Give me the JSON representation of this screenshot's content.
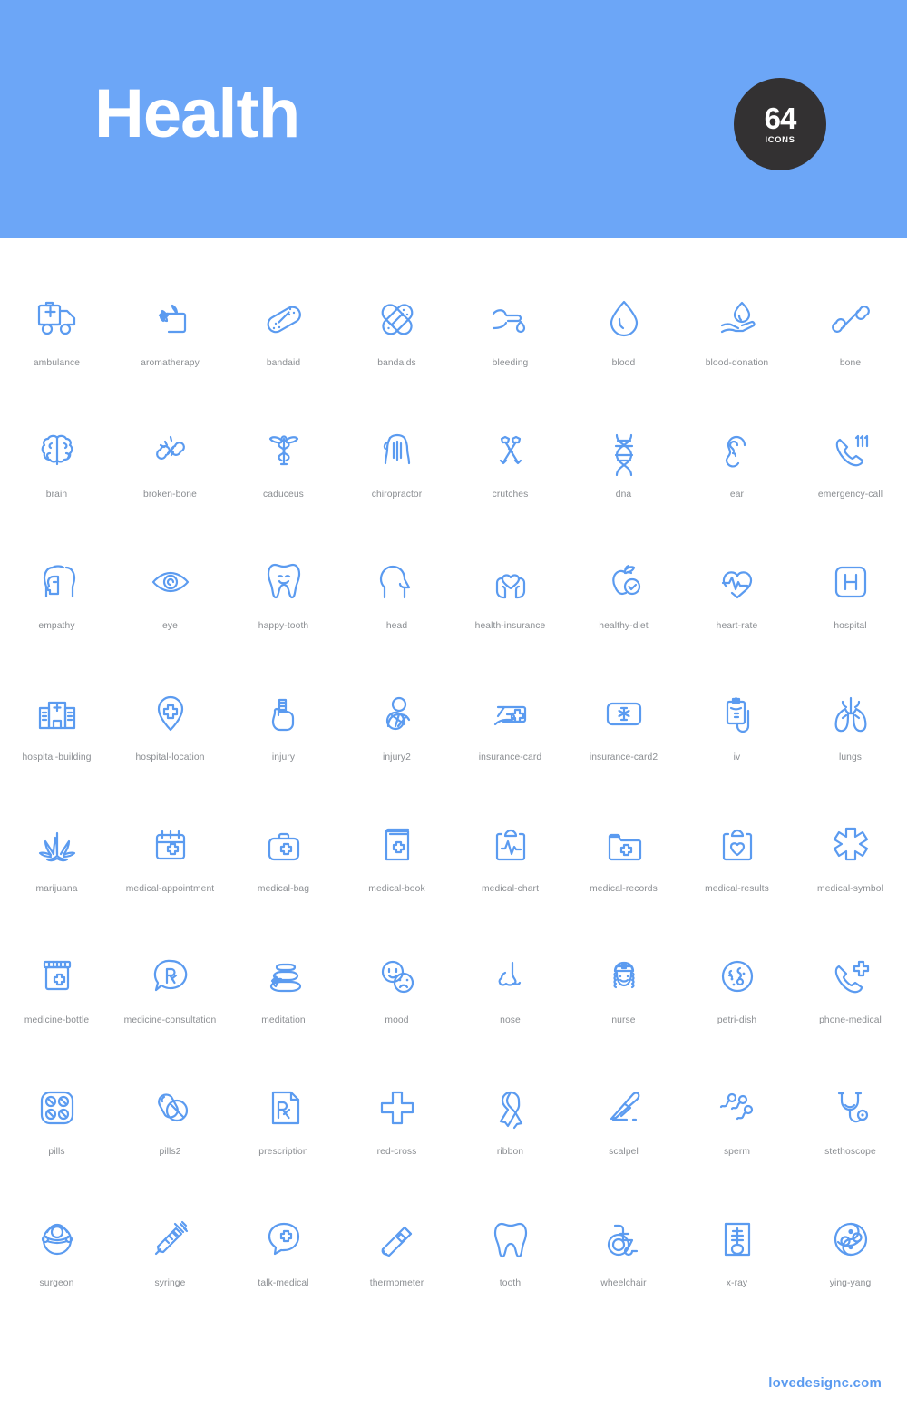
{
  "header": {
    "title": "Health",
    "badge_count": "64",
    "badge_label": "ICONS",
    "background_color": "#6ca6f7"
  },
  "theme": {
    "icon_color": "#5b9bf0",
    "label_color": "#8a8d91",
    "badge_color": "#333132",
    "page_background": "#ffffff"
  },
  "footer": {
    "site": "lovedesignc.com"
  },
  "grid": {
    "columns": 8,
    "rows": 8,
    "total": 64,
    "icons": [
      {
        "name": "ambulance",
        "label": "ambulance"
      },
      {
        "name": "aromatherapy",
        "label": "aromatherapy"
      },
      {
        "name": "bandaid",
        "label": "bandaid"
      },
      {
        "name": "bandaids",
        "label": "bandaids"
      },
      {
        "name": "bleeding",
        "label": "bleeding"
      },
      {
        "name": "blood",
        "label": "blood"
      },
      {
        "name": "blood-donation",
        "label": "blood-donation"
      },
      {
        "name": "bone",
        "label": "bone"
      },
      {
        "name": "brain",
        "label": "brain"
      },
      {
        "name": "broken-bone",
        "label": "broken-bone"
      },
      {
        "name": "caduceus",
        "label": "caduceus"
      },
      {
        "name": "chiropractor",
        "label": "chiropractor"
      },
      {
        "name": "crutches",
        "label": "crutches"
      },
      {
        "name": "dna",
        "label": "dna"
      },
      {
        "name": "ear",
        "label": "ear"
      },
      {
        "name": "emergency-call",
        "label": "emergency-call"
      },
      {
        "name": "empathy",
        "label": "empathy"
      },
      {
        "name": "eye",
        "label": "eye"
      },
      {
        "name": "happy-tooth",
        "label": "happy-tooth"
      },
      {
        "name": "head",
        "label": "head"
      },
      {
        "name": "health-insurance",
        "label": "health-insurance"
      },
      {
        "name": "healthy-diet",
        "label": "healthy-diet"
      },
      {
        "name": "heart-rate",
        "label": "heart-rate"
      },
      {
        "name": "hospital",
        "label": "hospital"
      },
      {
        "name": "hospital-building",
        "label": "hospital-building"
      },
      {
        "name": "hospital-location",
        "label": "hospital-location"
      },
      {
        "name": "injury",
        "label": "injury"
      },
      {
        "name": "injury2",
        "label": "injury2"
      },
      {
        "name": "insurance-card",
        "label": "insurance-card"
      },
      {
        "name": "insurance-card2",
        "label": "insurance-card2"
      },
      {
        "name": "iv",
        "label": "iv"
      },
      {
        "name": "lungs",
        "label": "lungs"
      },
      {
        "name": "marijuana",
        "label": "marijuana"
      },
      {
        "name": "medical-appointment",
        "label": "medical-appointment"
      },
      {
        "name": "medical-bag",
        "label": "medical-bag"
      },
      {
        "name": "medical-book",
        "label": "medical-book"
      },
      {
        "name": "medical-chart",
        "label": "medical-chart"
      },
      {
        "name": "medical-records",
        "label": "medical-records"
      },
      {
        "name": "medical-results",
        "label": "medical-results"
      },
      {
        "name": "medical-symbol",
        "label": "medical-symbol"
      },
      {
        "name": "medicine-bottle",
        "label": "medicine-bottle"
      },
      {
        "name": "medicine-consultation",
        "label": "medicine-consultation"
      },
      {
        "name": "meditation",
        "label": "meditation"
      },
      {
        "name": "mood",
        "label": "mood"
      },
      {
        "name": "nose",
        "label": "nose"
      },
      {
        "name": "nurse",
        "label": "nurse"
      },
      {
        "name": "petri-dish",
        "label": "petri-dish"
      },
      {
        "name": "phone-medical",
        "label": "phone-medical"
      },
      {
        "name": "pills",
        "label": "pills"
      },
      {
        "name": "pills2",
        "label": "pills2"
      },
      {
        "name": "prescription",
        "label": "prescription"
      },
      {
        "name": "red-cross",
        "label": "red-cross"
      },
      {
        "name": "ribbon",
        "label": "ribbon"
      },
      {
        "name": "scalpel",
        "label": "scalpel"
      },
      {
        "name": "sperm",
        "label": "sperm"
      },
      {
        "name": "stethoscope",
        "label": "stethoscope"
      },
      {
        "name": "surgeon",
        "label": "surgeon"
      },
      {
        "name": "syringe",
        "label": "syringe"
      },
      {
        "name": "talk-medical",
        "label": "talk-medical"
      },
      {
        "name": "thermometer",
        "label": "thermometer"
      },
      {
        "name": "tooth",
        "label": "tooth"
      },
      {
        "name": "wheelchair",
        "label": "wheelchair"
      },
      {
        "name": "x-ray",
        "label": "x-ray"
      },
      {
        "name": "ying-yang",
        "label": "ying-yang"
      }
    ]
  }
}
